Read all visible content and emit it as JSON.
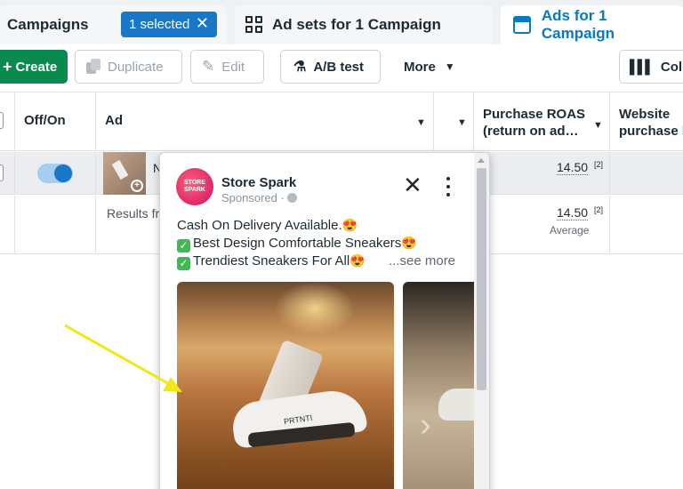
{
  "tabs": {
    "campaigns": {
      "label": "Campaigns",
      "selected_pill": "1 selected"
    },
    "adsets": {
      "label": "Ad sets for 1 Campaign"
    },
    "ads": {
      "label": "Ads for 1 Campaign"
    }
  },
  "toolbar": {
    "create": "Create",
    "duplicate": "Duplicate",
    "edit": "Edit",
    "ab_test": "A/B test",
    "more": "More",
    "columns": "Colu"
  },
  "table": {
    "headers": {
      "offon": "Off/On",
      "ad": "Ad",
      "roas_line1": "Purchase ROAS",
      "roas_line2": "(return on ad…",
      "website_line1": "Website",
      "website_line2": "purchase R"
    },
    "row1": {
      "ad_name": "N",
      "roas": "14.50",
      "roas_footnote": "[2]"
    },
    "row2": {
      "results_text": "Results fr",
      "roas": "14.50",
      "roas_footnote": "[2]",
      "roas_sub": "Average"
    }
  },
  "preview": {
    "page_name": "Store Spark",
    "avatar_text": "STORE SPARK",
    "sponsored": "Sponsored ·",
    "line1": "Cash On Delivery Available.",
    "line2": "Best Design Comfortable Sneakers",
    "line3": "Trendiest Sneakers For All",
    "see_more": "...see more",
    "sneaker_brand": "PRTNTI"
  },
  "colors": {
    "accent": "#1877c6",
    "create_green": "#0b8a4f",
    "annotation": "#f3e615"
  }
}
